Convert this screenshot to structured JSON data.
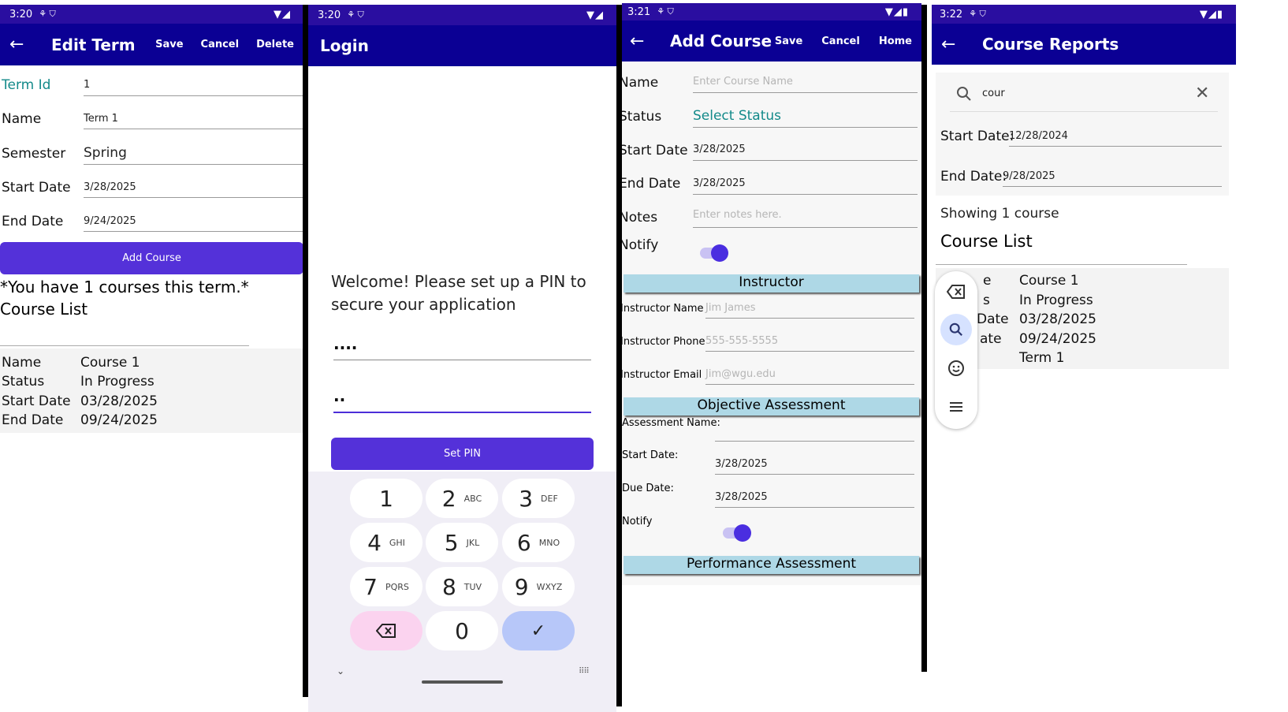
{
  "edit_term": {
    "status_time": "3:20",
    "title": "Edit Term",
    "actions": [
      "Save",
      "Cancel",
      "Delete"
    ],
    "fields": [
      {
        "label": "Term Id",
        "value": "1"
      },
      {
        "label": "Name",
        "value": "Term 1"
      },
      {
        "label": "Semester",
        "value": "Spring"
      },
      {
        "label": "Start Date",
        "value": "3/28/2025"
      },
      {
        "label": "End Date",
        "value": "9/24/2025"
      }
    ],
    "add_course": "Add Course",
    "course_count_text": "*You have 1 courses this term.*",
    "course_list_title": "Course List",
    "course": [
      {
        "label": "Name",
        "value": "Course 1"
      },
      {
        "label": "Status",
        "value": "In Progress"
      },
      {
        "label": "Start Date",
        "value": "03/28/2025"
      },
      {
        "label": "End Date",
        "value": "09/24/2025"
      }
    ]
  },
  "login": {
    "status_time": "3:20",
    "title": "Login",
    "welcome": "Welcome! Please set up a PIN to secure your application",
    "pin1": "....",
    "pin2": "..",
    "set_pin": "Set PIN",
    "keys": [
      {
        "n": "1",
        "s": ""
      },
      {
        "n": "2",
        "s": "ABC"
      },
      {
        "n": "3",
        "s": "DEF"
      },
      {
        "n": "4",
        "s": "GHI"
      },
      {
        "n": "5",
        "s": "JKL"
      },
      {
        "n": "6",
        "s": "MNO"
      },
      {
        "n": "7",
        "s": "PQRS"
      },
      {
        "n": "8",
        "s": "TUV"
      },
      {
        "n": "9",
        "s": "WXYZ"
      },
      {
        "n": "0",
        "s": ""
      }
    ]
  },
  "add_course": {
    "status_time": "3:21",
    "title": "Add Course",
    "actions": [
      "Save",
      "Cancel",
      "Home"
    ],
    "name_label": "Name",
    "name_placeholder": "Enter Course Name",
    "status_label": "Status",
    "status_value": "Select Status",
    "start_label": "Start Date",
    "start_value": "3/28/2025",
    "end_label": "End Date",
    "end_value": "3/28/2025",
    "notes_label": "Notes",
    "notes_placeholder": "Enter notes here.",
    "notify_label": "Notify",
    "instructor_header": "Instructor",
    "instructor_name_label": "Instructor Name",
    "instructor_name_ph": "Jim James",
    "instructor_phone_label": "Instructor Phone",
    "instructor_phone_ph": "555-555-5555",
    "instructor_email_label": "Instructor Email",
    "instructor_email_ph": "Jim@wgu.edu",
    "objective_header": "Objective Assessment",
    "assessment_name_label": "Assessment Name:",
    "oa_start_label": "Start Date:",
    "oa_start_value": "3/28/2025",
    "oa_due_label": "Due Date:",
    "oa_due_value": "3/28/2025",
    "oa_notify_label": "Notify",
    "performance_header": "Performance Assessment"
  },
  "reports": {
    "status_time": "3:22",
    "title": "Course Reports",
    "search_value": "cour",
    "start_label": "Start Date:",
    "start_value": "12/28/2024",
    "end_label": "End Date:",
    "end_value": "9/28/2025",
    "showing": "Showing 1 course",
    "course_list_title": "Course List",
    "labels_partial": [
      "e",
      "s",
      "Date",
      "ate"
    ],
    "values": [
      "Course 1",
      "In Progress",
      "03/28/2025",
      "09/24/2025",
      "Term 1"
    ]
  },
  "colors": {
    "appbar": "#0b0094",
    "status": "#2a0ea0",
    "accent": "#5431d9",
    "section": "#aed8e6"
  }
}
